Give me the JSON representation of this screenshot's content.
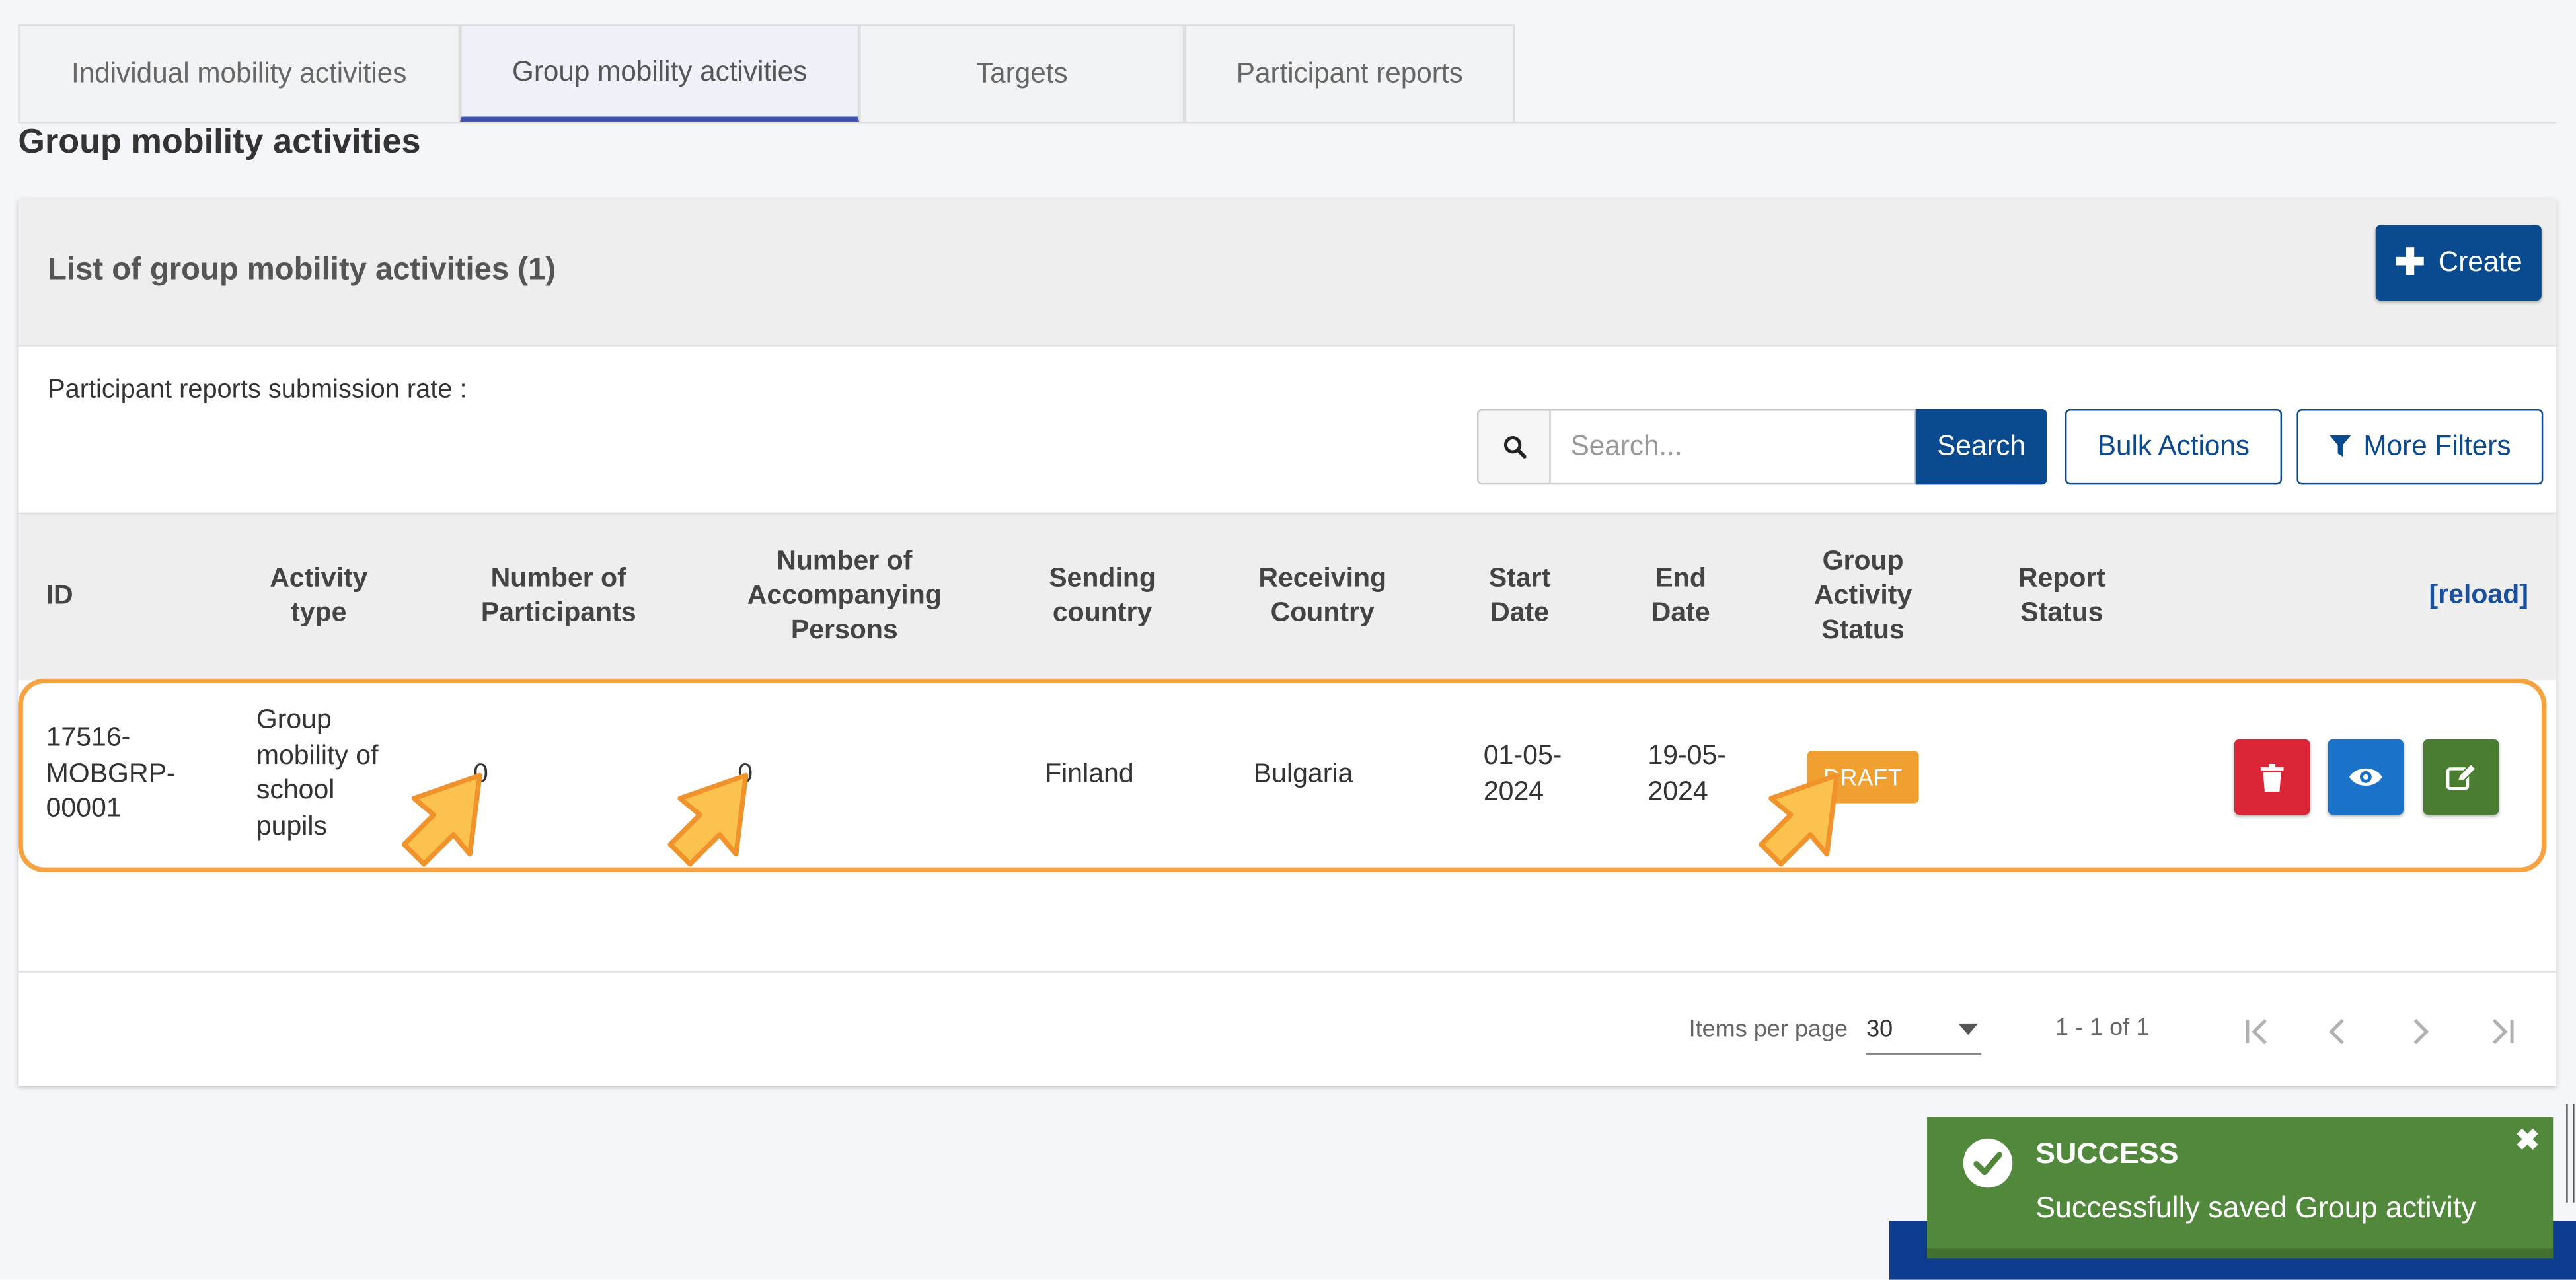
{
  "tabs": [
    {
      "label": "Individual mobility activities"
    },
    {
      "label": "Group mobility activities"
    },
    {
      "label": "Targets"
    },
    {
      "label": "Participant reports"
    }
  ],
  "page": {
    "title": "Group mobility activities"
  },
  "card": {
    "title": "List of group mobility activities (1)",
    "create_label": "Create"
  },
  "rate": {
    "label": "Participant reports submission rate :"
  },
  "search": {
    "placeholder": "Search...",
    "button_label": "Search"
  },
  "bulk_actions_label": "Bulk Actions",
  "more_filters_label": "More Filters",
  "table": {
    "headers": {
      "id": "ID",
      "activity_type": [
        "Activity",
        "type"
      ],
      "participants": [
        "Number of",
        "Participants"
      ],
      "accompanying": [
        "Number of",
        "Accompanying",
        "Persons"
      ],
      "sending": [
        "Sending",
        "country"
      ],
      "receiving": [
        "Receiving",
        "Country"
      ],
      "start": [
        "Start",
        "Date"
      ],
      "end": [
        "End",
        "Date"
      ],
      "group_status": [
        "Group",
        "Activity",
        "Status"
      ],
      "report_status": [
        "Report",
        "Status"
      ]
    },
    "reload_label": "[reload]",
    "rows": [
      {
        "id": [
          "17516-",
          "MOBGRP-",
          "00001"
        ],
        "activity_type": [
          "Group",
          "mobility of",
          "school",
          "pupils"
        ],
        "participants": "0",
        "accompanying": "0",
        "sending": "Finland",
        "receiving": "Bulgaria",
        "start": [
          "01-05-",
          "2024"
        ],
        "end": [
          "19-05-",
          "2024"
        ],
        "group_status": "DRAFT",
        "report_status": ""
      }
    ]
  },
  "pagination": {
    "items_per_page_label": "Items per page",
    "items_per_page_value": "30",
    "range": "1 - 1 of 1"
  },
  "toast": {
    "title": "SUCCESS",
    "message": "Successfully saved Group activity",
    "close_glyph": "✖"
  },
  "colors": {
    "primary": "#0a4a8e",
    "tab_active_underline": "#3f51b5",
    "draft_badge": "#f0a030",
    "delete": "#dc2537",
    "view": "#1a73c8",
    "edit": "#4a7d32",
    "toast_bg": "#51883b",
    "highlight": "#f5a243"
  },
  "icons": {
    "create": "plus-icon",
    "search": "magnifier-icon",
    "filter": "funnel-icon",
    "delete": "trash-icon",
    "view": "eye-icon",
    "edit": "edit-icon",
    "toast": "check-circle-icon"
  }
}
